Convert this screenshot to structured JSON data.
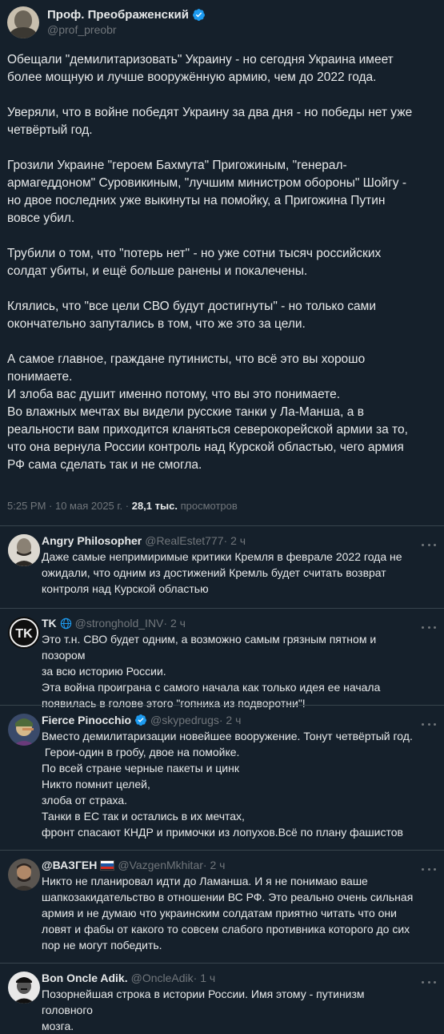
{
  "tweet": {
    "display_name": "Проф. Преображенский",
    "handle": "@prof_preobr",
    "verified_icon": "verified-badge-icon",
    "text": "Обещали \"демилитаризовать\" Украину - но сегодня Украина имеет\nболее мощную и лучше вооружённую армию, чем до 2022 года.\n\nУверяли, что в войне победят Украину за два дня - но победы нет уже\nчетвёртый год.\n\nГрозили Украине \"героем Бахмута\" Пригожиным, \"генерал-\nармагеддоном\" Суровикиным, \"лучшим министром обороны\" Шойгу -\nно двое последних уже выкинуты на помойку, а Пригожина Путин\nвовсе убил.\n\nТрубили о том, что \"потерь нет\" - но уже сотни тысяч российских\nсолдат убиты, и ещё больше ранены и покалечены.\n\nКлялись, что \"все цели СВО будут достигнуты\" - но только сами\nокончательно запутались в том, что же это за цели.\n\nА самое главное, граждане путинисты, что всё это вы хорошо\nпонимаете.\nИ злоба вас душит именно потому, что вы это понимаете.\nВо влажных мечтах вы видели русские танки у Ла-Манша, а в\nреальности вам приходится кланяться северокорейской армии за то,\nчто она вернула России контроль над Курской областью, чего армия\nРФ сама сделать так и не смогла.",
    "time_date": "5:25 PM · 10 мая 2025 г. · ",
    "views_count": "28,1 тыс.",
    "views_label": " просмотров"
  },
  "replies": [
    {
      "name": "Angry Philosopher",
      "handle": "@RealEstet777",
      "time": " · 2 ч",
      "text": "Даже самые непримиримые критики Кремля в феврале 2022 года не\nожидали, что одним из достижений Кремль будет считать возврат\nконтроля над Курской областью"
    },
    {
      "name": "TK",
      "handle": "@stronghold_INV",
      "time": " · 2 ч",
      "avatar_text": "TK",
      "text": "Это т.н. СВО будет одним, а возможно самым грязным пятном и позором\nза всю историю России.\nЭта война проиграна с самого начала как только идея ее начала\nпоявилась в голове этого \"гопника из подворотни\"!"
    },
    {
      "name": "Fierce Pinocchio",
      "handle": "@skypedrugs",
      "time": " · 2 ч",
      "text": "Вместо демилитаризации новейшее вооружение. Тонут четвёртый год.\n Герои-один в гробу, двое на помойке.\nПо всей стране черные пакеты и цинк\nНикто помнит целей,\nзлоба от страха.\nТанки в ЕС так и остались в их мечтах,\nфронт спасают КНДР и примочки из лопухов.Всё по плану фашистов"
    },
    {
      "name": "@ВАЗГЕН",
      "handle": "@VazgenMkhitar",
      "time": " · 2 ч",
      "text": "Никто не планировал идти до Ламанша. И я не понимаю ваше\nшапкозакидательство в отношении ВС РФ. Это реально очень сильная\nармия и не думаю что украинским солдатам приятно читать что они\nловят и фабы от какого то совсем слабого противника которого до сих\nпор не могут победить."
    },
    {
      "name": "Bon Oncle Adik.",
      "handle": "@OncleAdik",
      "time": " · 1 ч",
      "text": "Позорнейшая строка в истории России. Имя этому - путинизм головного\nмозга."
    }
  ],
  "colors": {
    "background": "#15202b",
    "text": "#e7e9ea",
    "muted": "#71767b",
    "verified": "#1d9bf0",
    "divider": "#38444d"
  }
}
